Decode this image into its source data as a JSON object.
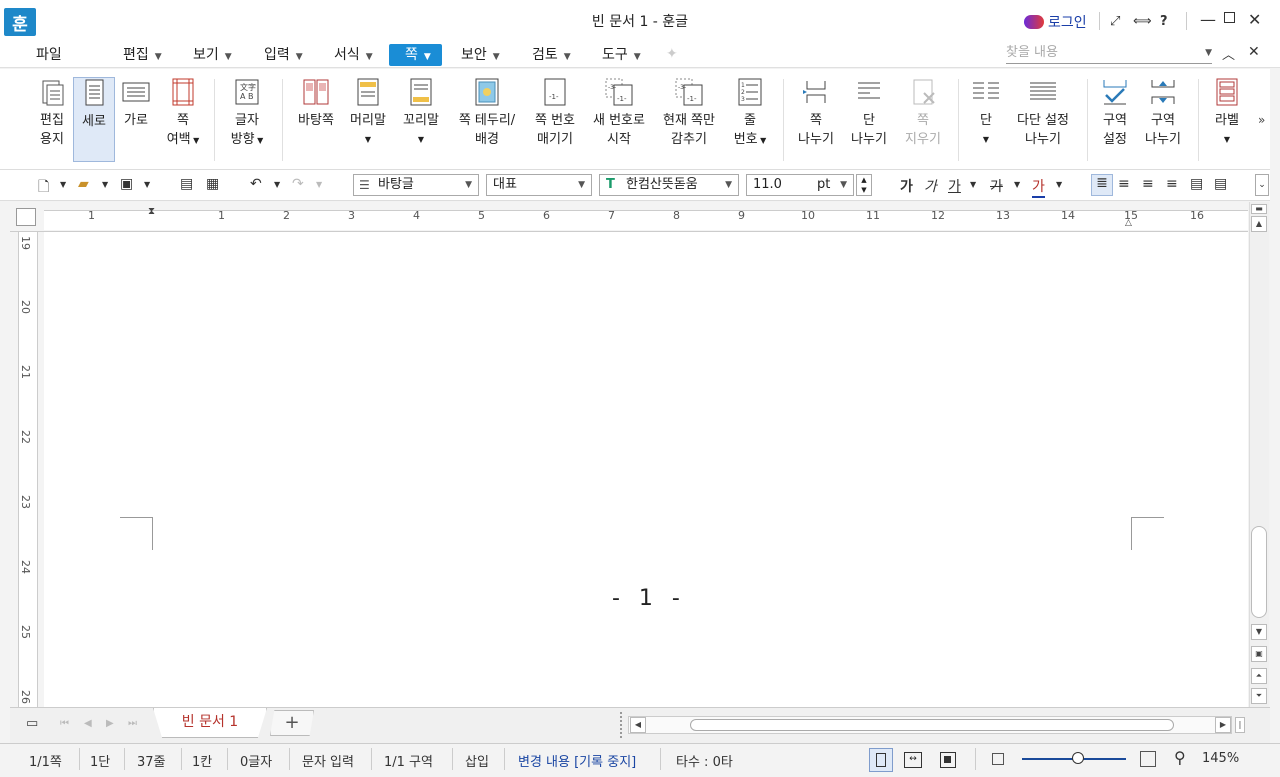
{
  "titlebar": {
    "logo": "훈",
    "title": "빈 문서 1 - 훈글",
    "login": "로그인",
    "help": "?"
  },
  "menu": {
    "file": "파일",
    "items": [
      "편집",
      "보기",
      "입력",
      "서식",
      "쪽",
      "보안",
      "검토",
      "도구"
    ],
    "active_index": 4,
    "find_placeholder": "찾을 내용"
  },
  "ribbon": {
    "buttons": [
      {
        "l1": "편집",
        "l2": "용지"
      },
      {
        "l1": "세로",
        "l2": ""
      },
      {
        "l1": "가로",
        "l2": ""
      },
      {
        "l1": "쪽",
        "l2": "여백"
      },
      {
        "l1": "글자",
        "l2": "방향"
      },
      {
        "l1": "바탕쪽",
        "l2": ""
      },
      {
        "l1": "머리말",
        "l2": ""
      },
      {
        "l1": "꼬리말",
        "l2": ""
      },
      {
        "l1": "쪽 테두리/",
        "l2": "배경"
      },
      {
        "l1": "쪽 번호",
        "l2": "매기기"
      },
      {
        "l1": "새 번호로",
        "l2": "시작"
      },
      {
        "l1": "현재 쪽만",
        "l2": "감추기"
      },
      {
        "l1": "줄",
        "l2": "번호"
      },
      {
        "l1": "쪽",
        "l2": "나누기"
      },
      {
        "l1": "단",
        "l2": "나누기"
      },
      {
        "l1": "쪽",
        "l2": "지우기"
      },
      {
        "l1": "단",
        "l2": ""
      },
      {
        "l1": "다단 설정",
        "l2": "나누기"
      },
      {
        "l1": "구역",
        "l2": "설정"
      },
      {
        "l1": "구역",
        "l2": "나누기"
      },
      {
        "l1": "라벨",
        "l2": ""
      }
    ]
  },
  "toolbar": {
    "style": "바탕글",
    "lang": "대표",
    "font": "한컴산뜻돋움",
    "size": "11.0",
    "unit": "pt",
    "bold": "가",
    "italic": "가",
    "underline": "가",
    "strike": "가",
    "color": "가"
  },
  "ruler": {
    "top": [
      "1",
      "1",
      "2",
      "3",
      "4",
      "5",
      "6",
      "7",
      "8",
      "9",
      "10",
      "11",
      "12",
      "13",
      "14",
      "15",
      "16"
    ],
    "left": [
      "19",
      "20",
      "21",
      "22",
      "23",
      "24",
      "25",
      "26"
    ]
  },
  "document": {
    "page_number": "- 1 -"
  },
  "tabs": {
    "doc_tab": "빈 문서 1",
    "add": "+"
  },
  "status": {
    "page": "1/1쪽",
    "column": "1단",
    "line": "37줄",
    "col": "1칸",
    "chars": "0글자",
    "mode": "문자 입력",
    "section": "1/1 구역",
    "insert": "삽입",
    "track": "변경 내용 [기록 중지]",
    "typing": "타수 : 0타",
    "zoom": "145%"
  }
}
